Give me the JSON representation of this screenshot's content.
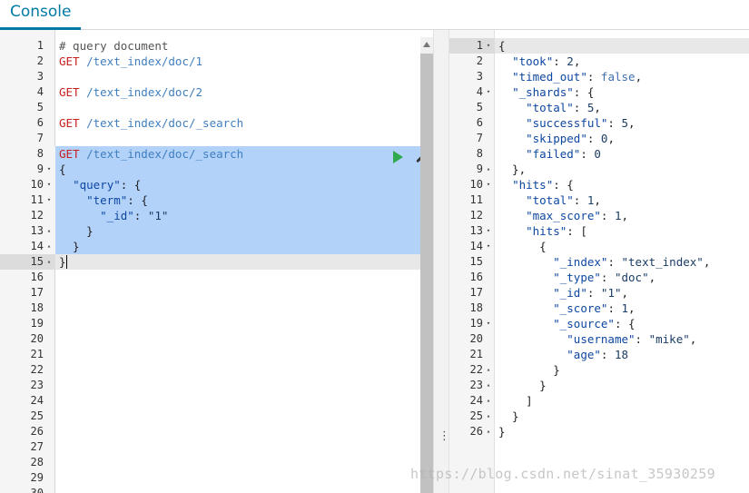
{
  "app": {
    "title": "Console"
  },
  "request": {
    "lines": [
      {
        "n": "1",
        "fold": "",
        "parts": [
          {
            "t": "# query document",
            "c": "cmt"
          }
        ]
      },
      {
        "n": "2",
        "fold": "",
        "parts": [
          {
            "t": "GET",
            "c": "req-method"
          },
          {
            "t": " /text_index/doc/1",
            "c": "req-url"
          }
        ]
      },
      {
        "n": "3",
        "fold": "",
        "parts": []
      },
      {
        "n": "4",
        "fold": "",
        "parts": [
          {
            "t": "GET",
            "c": "req-method"
          },
          {
            "t": " /text_index/doc/2",
            "c": "req-url"
          }
        ]
      },
      {
        "n": "5",
        "fold": "",
        "parts": []
      },
      {
        "n": "6",
        "fold": "",
        "parts": [
          {
            "t": "GET",
            "c": "req-method"
          },
          {
            "t": " /text_index/doc/_search",
            "c": "req-url"
          }
        ]
      },
      {
        "n": "7",
        "fold": "",
        "parts": []
      },
      {
        "n": "8",
        "fold": "",
        "sel": true,
        "parts": [
          {
            "t": "GET",
            "c": "req-method"
          },
          {
            "t": " /text_index/doc/_search",
            "c": "req-url"
          }
        ]
      },
      {
        "n": "9",
        "fold": "▾",
        "sel": true,
        "parts": [
          {
            "t": "{",
            "c": "pun"
          }
        ]
      },
      {
        "n": "10",
        "fold": "▾",
        "sel": true,
        "parts": [
          {
            "t": "  ",
            "c": "pun"
          },
          {
            "t": "\"query\"",
            "c": "key"
          },
          {
            "t": ": {",
            "c": "pun"
          }
        ]
      },
      {
        "n": "11",
        "fold": "▾",
        "sel": true,
        "parts": [
          {
            "t": "    ",
            "c": "pun"
          },
          {
            "t": "\"term\"",
            "c": "key"
          },
          {
            "t": ": {",
            "c": "pun"
          }
        ]
      },
      {
        "n": "12",
        "fold": "",
        "sel": true,
        "parts": [
          {
            "t": "      ",
            "c": "pun"
          },
          {
            "t": "\"_id\"",
            "c": "key"
          },
          {
            "t": ": ",
            "c": "pun"
          },
          {
            "t": "\"1\"",
            "c": "str"
          }
        ]
      },
      {
        "n": "13",
        "fold": "▴",
        "sel": true,
        "parts": [
          {
            "t": "    }",
            "c": "pun"
          }
        ]
      },
      {
        "n": "14",
        "fold": "▴",
        "sel": true,
        "parts": [
          {
            "t": "  }",
            "c": "pun"
          }
        ]
      },
      {
        "n": "15",
        "fold": "▴",
        "cur": true,
        "parts": [
          {
            "t": "}",
            "c": "pun"
          }
        ]
      },
      {
        "n": "16",
        "fold": "",
        "parts": []
      },
      {
        "n": "17",
        "fold": "",
        "parts": []
      },
      {
        "n": "18",
        "fold": "",
        "parts": []
      },
      {
        "n": "19",
        "fold": "",
        "parts": []
      },
      {
        "n": "20",
        "fold": "",
        "parts": []
      },
      {
        "n": "21",
        "fold": "",
        "parts": []
      },
      {
        "n": "22",
        "fold": "",
        "parts": []
      },
      {
        "n": "23",
        "fold": "",
        "parts": []
      },
      {
        "n": "24",
        "fold": "",
        "parts": []
      },
      {
        "n": "25",
        "fold": "",
        "parts": []
      },
      {
        "n": "26",
        "fold": "",
        "parts": []
      },
      {
        "n": "27",
        "fold": "",
        "parts": []
      },
      {
        "n": "28",
        "fold": "",
        "parts": []
      },
      {
        "n": "29",
        "fold": "",
        "parts": []
      },
      {
        "n": "30",
        "fold": "",
        "parts": []
      }
    ],
    "actions": {
      "run_icon": "play-icon",
      "settings_icon": "wrench-icon"
    }
  },
  "response": {
    "lines": [
      {
        "n": "1",
        "fold": "▾",
        "cur": true,
        "parts": [
          {
            "t": "{",
            "c": "pun"
          }
        ]
      },
      {
        "n": "2",
        "fold": "",
        "parts": [
          {
            "t": "  ",
            "c": "pun"
          },
          {
            "t": "\"took\"",
            "c": "key"
          },
          {
            "t": ": ",
            "c": "pun"
          },
          {
            "t": "2",
            "c": "num"
          },
          {
            "t": ",",
            "c": "pun"
          }
        ]
      },
      {
        "n": "3",
        "fold": "",
        "parts": [
          {
            "t": "  ",
            "c": "pun"
          },
          {
            "t": "\"timed_out\"",
            "c": "key"
          },
          {
            "t": ": ",
            "c": "pun"
          },
          {
            "t": "false",
            "c": "bool"
          },
          {
            "t": ",",
            "c": "pun"
          }
        ]
      },
      {
        "n": "4",
        "fold": "▾",
        "parts": [
          {
            "t": "  ",
            "c": "pun"
          },
          {
            "t": "\"_shards\"",
            "c": "key"
          },
          {
            "t": ": {",
            "c": "pun"
          }
        ]
      },
      {
        "n": "5",
        "fold": "",
        "parts": [
          {
            "t": "    ",
            "c": "pun"
          },
          {
            "t": "\"total\"",
            "c": "key"
          },
          {
            "t": ": ",
            "c": "pun"
          },
          {
            "t": "5",
            "c": "num"
          },
          {
            "t": ",",
            "c": "pun"
          }
        ]
      },
      {
        "n": "6",
        "fold": "",
        "parts": [
          {
            "t": "    ",
            "c": "pun"
          },
          {
            "t": "\"successful\"",
            "c": "key"
          },
          {
            "t": ": ",
            "c": "pun"
          },
          {
            "t": "5",
            "c": "num"
          },
          {
            "t": ",",
            "c": "pun"
          }
        ]
      },
      {
        "n": "7",
        "fold": "",
        "parts": [
          {
            "t": "    ",
            "c": "pun"
          },
          {
            "t": "\"skipped\"",
            "c": "key"
          },
          {
            "t": ": ",
            "c": "pun"
          },
          {
            "t": "0",
            "c": "num"
          },
          {
            "t": ",",
            "c": "pun"
          }
        ]
      },
      {
        "n": "8",
        "fold": "",
        "parts": [
          {
            "t": "    ",
            "c": "pun"
          },
          {
            "t": "\"failed\"",
            "c": "key"
          },
          {
            "t": ": ",
            "c": "pun"
          },
          {
            "t": "0",
            "c": "num"
          }
        ]
      },
      {
        "n": "9",
        "fold": "▴",
        "parts": [
          {
            "t": "  },",
            "c": "pun"
          }
        ]
      },
      {
        "n": "10",
        "fold": "▾",
        "parts": [
          {
            "t": "  ",
            "c": "pun"
          },
          {
            "t": "\"hits\"",
            "c": "key"
          },
          {
            "t": ": {",
            "c": "pun"
          }
        ]
      },
      {
        "n": "11",
        "fold": "",
        "parts": [
          {
            "t": "    ",
            "c": "pun"
          },
          {
            "t": "\"total\"",
            "c": "key"
          },
          {
            "t": ": ",
            "c": "pun"
          },
          {
            "t": "1",
            "c": "num"
          },
          {
            "t": ",",
            "c": "pun"
          }
        ]
      },
      {
        "n": "12",
        "fold": "",
        "parts": [
          {
            "t": "    ",
            "c": "pun"
          },
          {
            "t": "\"max_score\"",
            "c": "key"
          },
          {
            "t": ": ",
            "c": "pun"
          },
          {
            "t": "1",
            "c": "num"
          },
          {
            "t": ",",
            "c": "pun"
          }
        ]
      },
      {
        "n": "13",
        "fold": "▾",
        "parts": [
          {
            "t": "    ",
            "c": "pun"
          },
          {
            "t": "\"hits\"",
            "c": "key"
          },
          {
            "t": ": [",
            "c": "pun"
          }
        ]
      },
      {
        "n": "14",
        "fold": "▾",
        "parts": [
          {
            "t": "      {",
            "c": "pun"
          }
        ]
      },
      {
        "n": "15",
        "fold": "",
        "parts": [
          {
            "t": "        ",
            "c": "pun"
          },
          {
            "t": "\"_index\"",
            "c": "key"
          },
          {
            "t": ": ",
            "c": "pun"
          },
          {
            "t": "\"text_index\"",
            "c": "str"
          },
          {
            "t": ",",
            "c": "pun"
          }
        ]
      },
      {
        "n": "16",
        "fold": "",
        "parts": [
          {
            "t": "        ",
            "c": "pun"
          },
          {
            "t": "\"_type\"",
            "c": "key"
          },
          {
            "t": ": ",
            "c": "pun"
          },
          {
            "t": "\"doc\"",
            "c": "str"
          },
          {
            "t": ",",
            "c": "pun"
          }
        ]
      },
      {
        "n": "17",
        "fold": "",
        "parts": [
          {
            "t": "        ",
            "c": "pun"
          },
          {
            "t": "\"_id\"",
            "c": "key"
          },
          {
            "t": ": ",
            "c": "pun"
          },
          {
            "t": "\"1\"",
            "c": "str"
          },
          {
            "t": ",",
            "c": "pun"
          }
        ]
      },
      {
        "n": "18",
        "fold": "",
        "parts": [
          {
            "t": "        ",
            "c": "pun"
          },
          {
            "t": "\"_score\"",
            "c": "key"
          },
          {
            "t": ": ",
            "c": "pun"
          },
          {
            "t": "1",
            "c": "num"
          },
          {
            "t": ",",
            "c": "pun"
          }
        ]
      },
      {
        "n": "19",
        "fold": "▾",
        "parts": [
          {
            "t": "        ",
            "c": "pun"
          },
          {
            "t": "\"_source\"",
            "c": "key"
          },
          {
            "t": ": {",
            "c": "pun"
          }
        ]
      },
      {
        "n": "20",
        "fold": "",
        "parts": [
          {
            "t": "          ",
            "c": "pun"
          },
          {
            "t": "\"username\"",
            "c": "key"
          },
          {
            "t": ": ",
            "c": "pun"
          },
          {
            "t": "\"mike\"",
            "c": "str"
          },
          {
            "t": ",",
            "c": "pun"
          }
        ]
      },
      {
        "n": "21",
        "fold": "",
        "parts": [
          {
            "t": "          ",
            "c": "pun"
          },
          {
            "t": "\"age\"",
            "c": "key"
          },
          {
            "t": ": ",
            "c": "pun"
          },
          {
            "t": "18",
            "c": "num"
          }
        ]
      },
      {
        "n": "22",
        "fold": "▴",
        "parts": [
          {
            "t": "        }",
            "c": "pun"
          }
        ]
      },
      {
        "n": "23",
        "fold": "▴",
        "parts": [
          {
            "t": "      }",
            "c": "pun"
          }
        ]
      },
      {
        "n": "24",
        "fold": "▴",
        "parts": [
          {
            "t": "    ]",
            "c": "pun"
          }
        ]
      },
      {
        "n": "25",
        "fold": "▴",
        "parts": [
          {
            "t": "  }",
            "c": "pun"
          }
        ]
      },
      {
        "n": "26",
        "fold": "▴",
        "parts": [
          {
            "t": "}",
            "c": "pun"
          }
        ]
      }
    ]
  },
  "divider": {
    "handle": "⋮"
  },
  "watermark": "https://blog.csdn.net/sinat_35930259",
  "colors": {
    "accent": "#0079a5",
    "selection": "#b3d2fa",
    "method": "#c81f1f",
    "url": "#3f7fbf",
    "run": "#2fa84f"
  }
}
